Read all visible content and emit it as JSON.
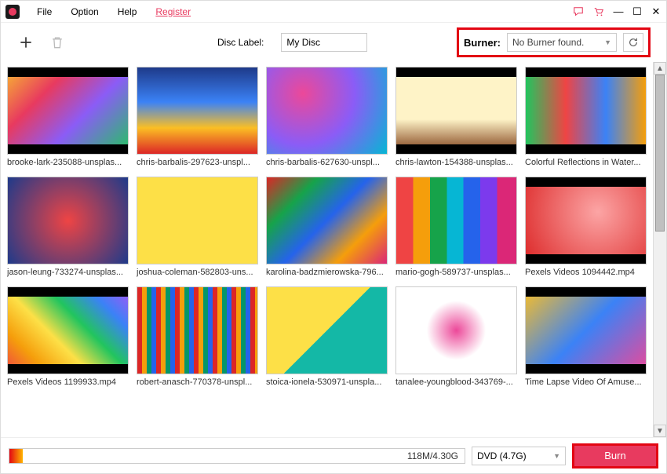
{
  "menubar": {
    "items": [
      "File",
      "Option",
      "Help"
    ],
    "register": "Register"
  },
  "toolbar": {
    "disc_label_text": "Disc Label:",
    "disc_label_value": "My Disc",
    "burner_label": "Burner:",
    "burner_value": "No Burner found."
  },
  "files": [
    {
      "name": "brooke-lark-235088-unsplas..."
    },
    {
      "name": "chris-barbalis-297623-unspl..."
    },
    {
      "name": "chris-barbalis-627630-unspl..."
    },
    {
      "name": "chris-lawton-154388-unsplas..."
    },
    {
      "name": "Colorful Reflections in Water..."
    },
    {
      "name": "jason-leung-733274-unsplas..."
    },
    {
      "name": "joshua-coleman-582803-uns..."
    },
    {
      "name": "karolina-badzmierowska-796..."
    },
    {
      "name": "mario-gogh-589737-unsplas..."
    },
    {
      "name": "Pexels Videos 1094442.mp4"
    },
    {
      "name": "Pexels Videos 1199933.mp4"
    },
    {
      "name": "robert-anasch-770378-unspl..."
    },
    {
      "name": "stoica-ionela-530971-unspla..."
    },
    {
      "name": "tanalee-youngblood-343769-..."
    },
    {
      "name": "Time Lapse Video Of Amuse..."
    }
  ],
  "bottom": {
    "progress_text": "118M/4.30G",
    "disc_type": "DVD (4.7G)",
    "burn_label": "Burn"
  }
}
